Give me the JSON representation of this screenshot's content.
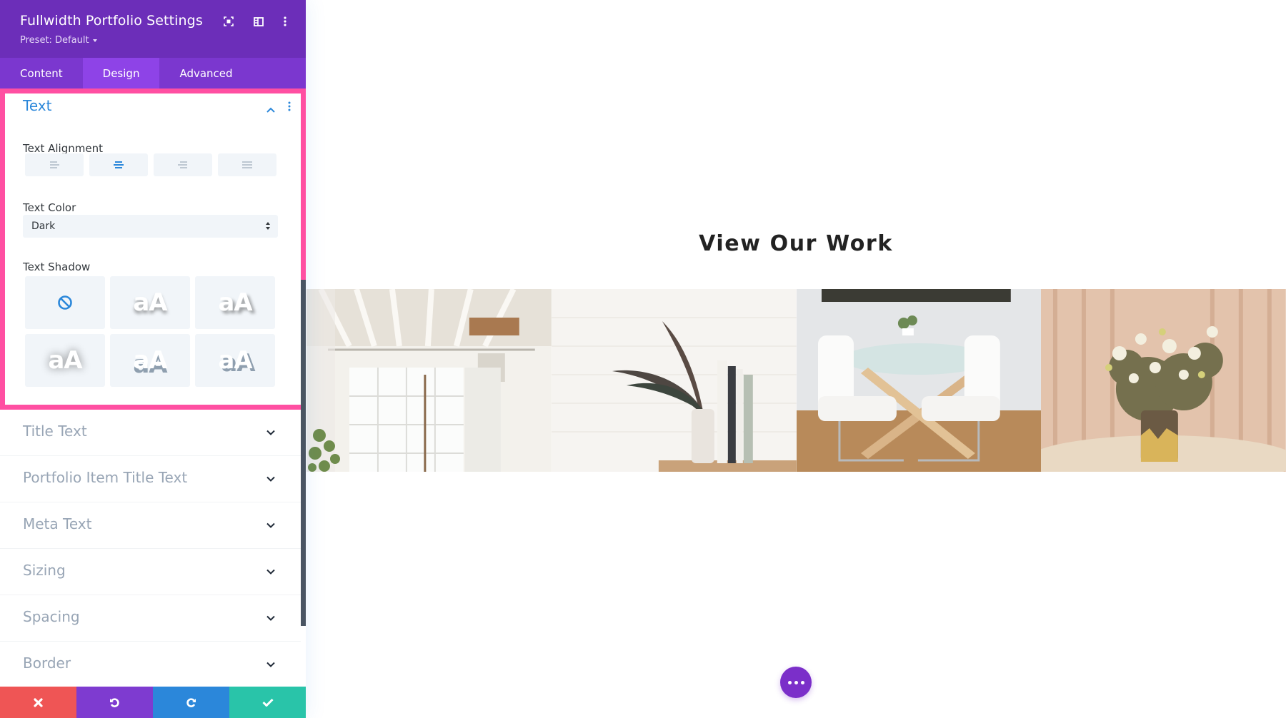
{
  "panel": {
    "title": "Fullwidth Portfolio Settings",
    "preset_label": "Preset: Default",
    "header_icons": [
      "focus-mode-icon",
      "split-view-icon",
      "more-options-icon"
    ],
    "tabs": [
      {
        "label": "Content",
        "active": false
      },
      {
        "label": "Design",
        "active": true
      },
      {
        "label": "Advanced",
        "active": false
      }
    ],
    "text_section": {
      "title": "Text",
      "expanded": true,
      "alignment": {
        "label": "Text Alignment",
        "options": [
          "left",
          "center",
          "right",
          "justify"
        ],
        "selected": "center"
      },
      "color": {
        "label": "Text Color",
        "value": "Dark"
      },
      "shadow": {
        "label": "Text Shadow",
        "preview_text": "aA",
        "options": [
          "none",
          "shadow-1",
          "shadow-2",
          "shadow-3",
          "shadow-4",
          "shadow-5"
        ],
        "selected": "none"
      }
    },
    "collapsed_sections": [
      {
        "label": "Title Text"
      },
      {
        "label": "Portfolio Item Title Text"
      },
      {
        "label": "Meta Text"
      },
      {
        "label": "Sizing"
      },
      {
        "label": "Spacing"
      },
      {
        "label": "Border"
      }
    ],
    "footer": [
      "discard",
      "undo",
      "redo",
      "save"
    ]
  },
  "canvas": {
    "heading": "View Our Work",
    "gallery": [
      {
        "subject": "white loft interior with windows"
      },
      {
        "subject": "plant and books on shelf against white brick wall"
      },
      {
        "subject": "glass dining table with white chairs"
      },
      {
        "subject": "flower bouquet in ceramic vase"
      }
    ]
  },
  "colors": {
    "header_bg": "#6c2eb9",
    "tabs_bg": "#7b37cf",
    "tab_active": "#8e43e7",
    "accent_blue": "#2b87da",
    "highlight_pink": "#ff4fa2",
    "discard_red": "#ef5555",
    "undo_purple": "#7e3bd0",
    "redo_blue": "#2b87da",
    "save_green": "#29c4a9"
  }
}
